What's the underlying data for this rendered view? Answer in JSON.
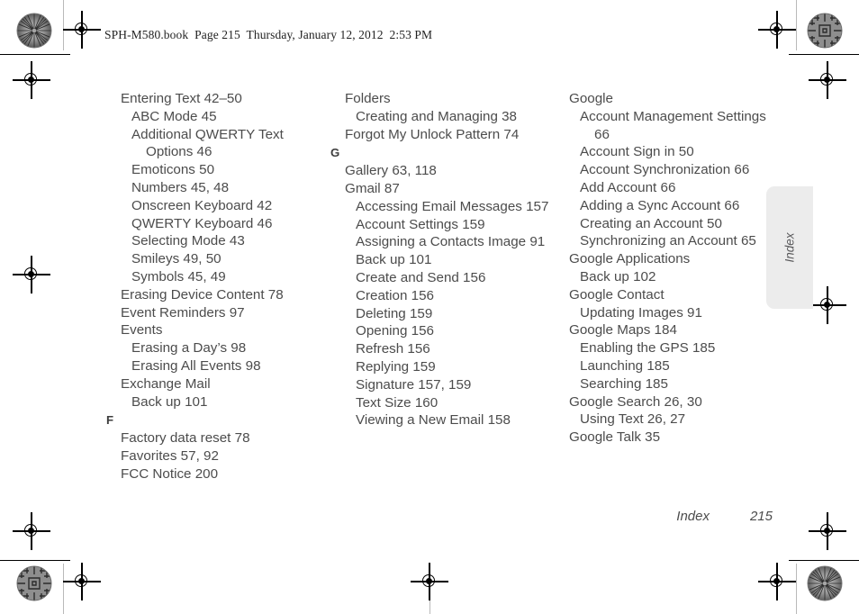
{
  "document": {
    "slug_line": "SPH-M580.book  Page 215  Thursday, January 12, 2012  2:53 PM",
    "side_tab_label": "Index",
    "footer_label": "Index",
    "footer_page_number": "215",
    "text_color": "#4c4c4c",
    "side_tab_color": "#ececec"
  },
  "columns": [
    {
      "id": "column-1",
      "entries": [
        {
          "level": 0,
          "text": "Entering Text 42–50"
        },
        {
          "level": 1,
          "text": "ABC Mode 45"
        },
        {
          "level": 1,
          "text": "Additional QWERTY Text Options 46"
        },
        {
          "level": 1,
          "text": "Emoticons 50"
        },
        {
          "level": 1,
          "text": "Numbers 45, 48"
        },
        {
          "level": 1,
          "text": "Onscreen Keyboard 42"
        },
        {
          "level": 1,
          "text": "QWERTY Keyboard 46"
        },
        {
          "level": 1,
          "text": "Selecting Mode 43"
        },
        {
          "level": 1,
          "text": "Smileys 49, 50"
        },
        {
          "level": 1,
          "text": "Symbols 45, 49"
        },
        {
          "level": 0,
          "text": "Erasing Device Content 78"
        },
        {
          "level": 0,
          "text": "Event Reminders 97"
        },
        {
          "level": 0,
          "text": "Events"
        },
        {
          "level": 1,
          "text": "Erasing a Day’s 98"
        },
        {
          "level": 1,
          "text": "Erasing All Events 98"
        },
        {
          "level": 0,
          "text": "Exchange Mail"
        },
        {
          "level": 1,
          "text": "Back up 101"
        },
        {
          "level": "letter",
          "text": "F"
        },
        {
          "level": 0,
          "text": "Factory data reset 78"
        },
        {
          "level": 0,
          "text": "Favorites 57, 92"
        },
        {
          "level": 0,
          "text": "FCC Notice 200"
        }
      ]
    },
    {
      "id": "column-2",
      "entries": [
        {
          "level": 0,
          "text": "Folders"
        },
        {
          "level": 1,
          "text": "Creating and Managing 38"
        },
        {
          "level": 0,
          "text": "Forgot My Unlock Pattern 74"
        },
        {
          "level": "letter",
          "text": "G"
        },
        {
          "level": 0,
          "text": "Gallery 63, 118"
        },
        {
          "level": 0,
          "text": "Gmail 87"
        },
        {
          "level": 1,
          "text": "Accessing Email Messages 157"
        },
        {
          "level": 1,
          "text": "Account Settings 159"
        },
        {
          "level": 1,
          "text": "Assigning a Contacts Image 91"
        },
        {
          "level": 1,
          "text": "Back up 101"
        },
        {
          "level": 1,
          "text": "Create and Send 156"
        },
        {
          "level": 1,
          "text": "Creation 156"
        },
        {
          "level": 1,
          "text": "Deleting 159"
        },
        {
          "level": 1,
          "text": "Opening 156"
        },
        {
          "level": 1,
          "text": "Refresh 156"
        },
        {
          "level": 1,
          "text": "Replying 159"
        },
        {
          "level": 1,
          "text": "Signature 157, 159"
        },
        {
          "level": 1,
          "text": "Text Size 160"
        },
        {
          "level": 1,
          "text": "Viewing a New Email 158"
        }
      ]
    },
    {
      "id": "column-3",
      "entries": [
        {
          "level": 0,
          "text": "Google"
        },
        {
          "level": 1,
          "text": "Account Management Settings 66"
        },
        {
          "level": 1,
          "text": "Account Sign in 50"
        },
        {
          "level": 1,
          "text": "Account Synchronization 66"
        },
        {
          "level": 1,
          "text": "Add Account 66"
        },
        {
          "level": 1,
          "text": "Adding a Sync Account 66"
        },
        {
          "level": 1,
          "text": "Creating an Account 50"
        },
        {
          "level": 1,
          "text": "Synchronizing an Account 65"
        },
        {
          "level": 0,
          "text": "Google Applications"
        },
        {
          "level": 1,
          "text": "Back up 102"
        },
        {
          "level": 0,
          "text": "Google Contact"
        },
        {
          "level": 1,
          "text": "Updating Images 91"
        },
        {
          "level": 0,
          "text": "Google Maps 184"
        },
        {
          "level": 1,
          "text": "Enabling the GPS 185"
        },
        {
          "level": 1,
          "text": "Launching 185"
        },
        {
          "level": 1,
          "text": "Searching 185"
        },
        {
          "level": 0,
          "text": "Google Search 26, 30"
        },
        {
          "level": 1,
          "text": "Using Text 26, 27"
        },
        {
          "level": 0,
          "text": "Google Talk 35"
        }
      ]
    }
  ],
  "print_marks": {
    "registration_targets": 8,
    "rosettes": 4,
    "description": "offset-press registration crosshairs and color rosette patches"
  }
}
